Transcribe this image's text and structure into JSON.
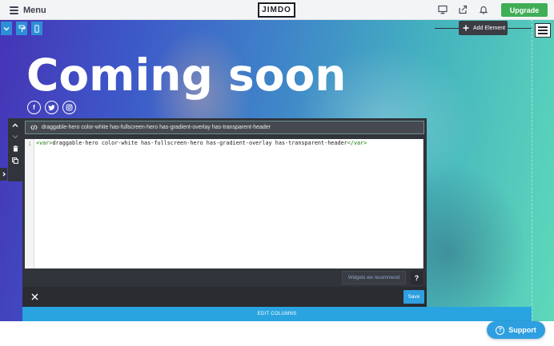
{
  "topbar": {
    "menu_label": "Menu",
    "logo_text": "JIMDO",
    "upgrade_label": "Upgrade",
    "icons": [
      "monitor-icon",
      "share-icon",
      "bell-icon"
    ],
    "upgrade_color": "#3fae56"
  },
  "hero": {
    "title": "Coming soon",
    "social": [
      "facebook",
      "twitter",
      "instagram"
    ],
    "add_element_label": "Add Element"
  },
  "editor": {
    "header_text": "draggable-hero color-white has-fullscreen-hero has-gradient-overlay has-transparent-header",
    "line_number": "1",
    "code_open_tag": "<var>",
    "code_body": "draggable-hero color-white has-fullscreen-hero has-gradient-overlay has-transparent-header",
    "code_close_tag": "</var>",
    "widgets_label": "Widgets we recommend",
    "help_label": "?",
    "save_label": "Save"
  },
  "edit_columns_label": "EDIT COLUMNS",
  "support_label": "Support",
  "colors": {
    "accent_blue": "#2e9fe0",
    "panel_dark": "#31343a"
  }
}
